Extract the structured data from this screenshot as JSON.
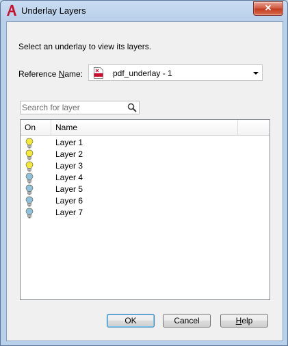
{
  "window": {
    "title": "Underlay Layers",
    "close_glyph": "✕"
  },
  "dialog": {
    "instruction": "Select an underlay to view its layers.",
    "reference": {
      "label_pre": "Reference ",
      "label_key": "N",
      "label_post": "ame:",
      "value": "pdf_underlay - 1"
    },
    "search": {
      "placeholder": "Search for layer",
      "value": ""
    },
    "list": {
      "columns": {
        "on": "On",
        "name": "Name"
      },
      "layers": [
        {
          "name": "Layer 1",
          "state": "on"
        },
        {
          "name": "Layer 2",
          "state": "on"
        },
        {
          "name": "Layer 3",
          "state": "on"
        },
        {
          "name": "Layer 4",
          "state": "off"
        },
        {
          "name": "Layer 5",
          "state": "off"
        },
        {
          "name": "Layer 6",
          "state": "off"
        },
        {
          "name": "Layer 7",
          "state": "off"
        }
      ]
    },
    "buttons": {
      "ok": "OK",
      "cancel": "Cancel",
      "help_key": "H",
      "help_rest": "elp"
    }
  },
  "icons": {
    "app": "autocad-app-icon",
    "pdf": "pdf-file-icon",
    "search": "magnifier-icon",
    "bulb_on": "lightbulb-on-icon",
    "bulb_off": "lightbulb-off-icon"
  },
  "colors": {
    "bulb_on": "#f5ea3a",
    "bulb_off": "#8fc0dd",
    "app_red": "#c8102e",
    "title_bg": "#c9dcf2"
  }
}
